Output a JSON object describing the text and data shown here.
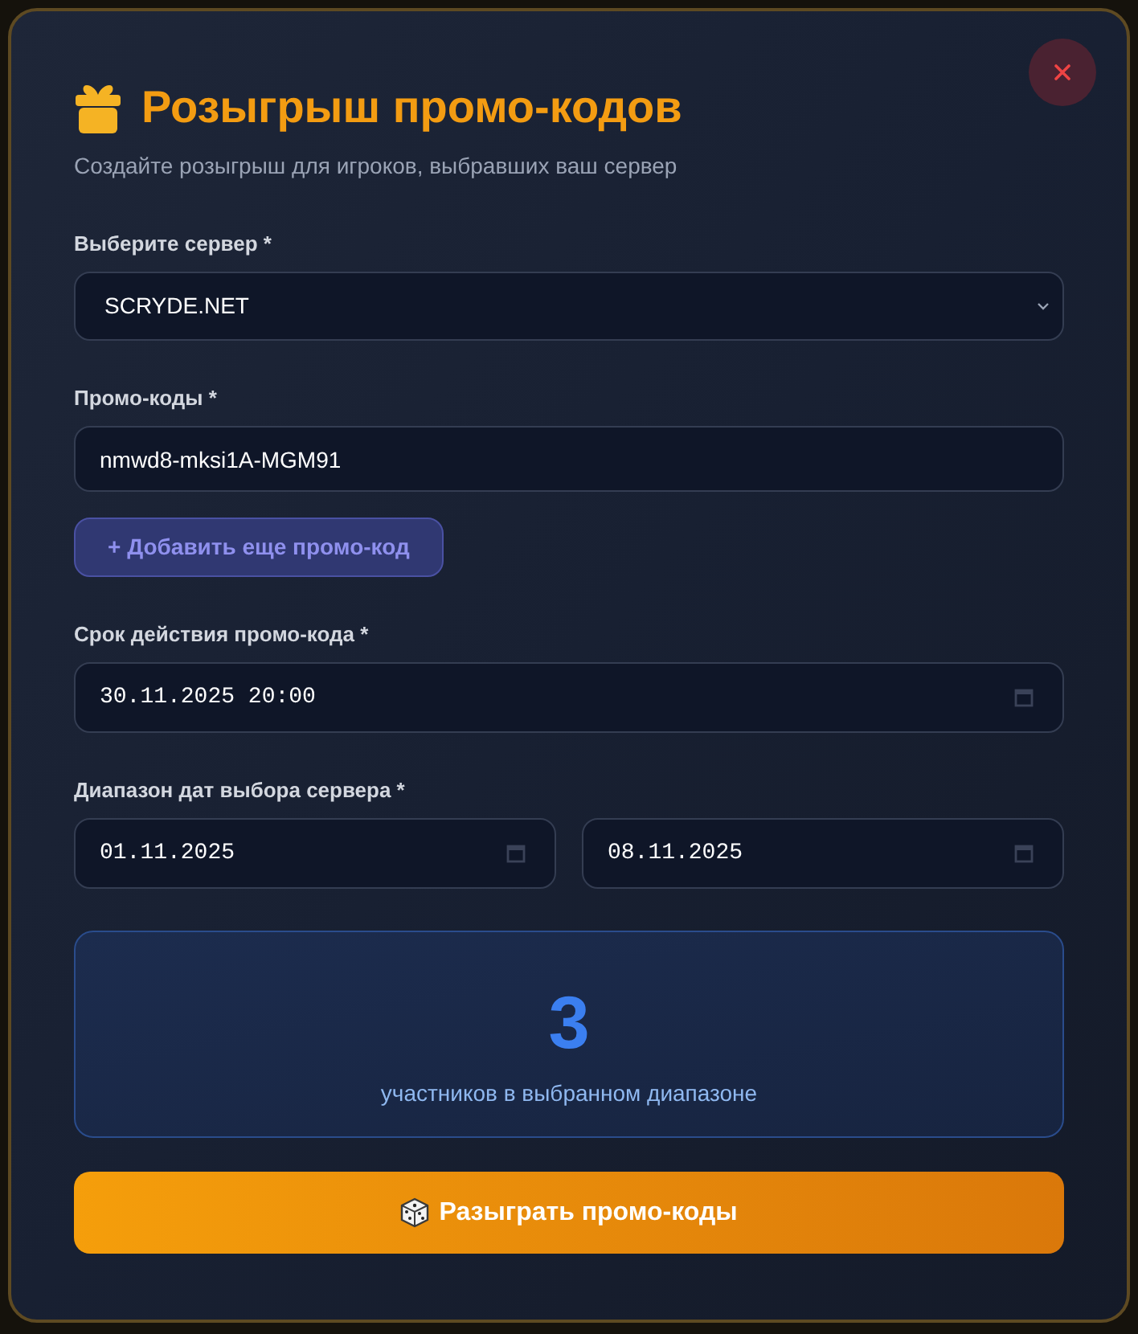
{
  "dialog": {
    "title": "Розыгрыш промо-кодов",
    "subtitle": "Создайте розыгрыш для игроков, выбравших ваш сервер"
  },
  "fields": [
    {
      "kind": "select",
      "label": "Выберите сервер *",
      "value": "SCRYDE.NET"
    },
    {
      "kind": "codes",
      "label": "Промо-коды *",
      "values": [
        "nmwd8-mksi1A-MGM91"
      ],
      "add_button": "+ Добавить еще промо-код"
    },
    {
      "kind": "datetime",
      "label": "Срок действия промо-кода *",
      "value": "30.11.2025 20:00"
    },
    {
      "kind": "date_range",
      "label": "Диапазон дат выбора сервера *",
      "values": [
        "01.11.2025",
        "08.11.2025"
      ]
    }
  ],
  "participants": {
    "count": "3",
    "caption": "участников в выбранном диапазоне"
  },
  "submit_button": {
    "label": "Разыграть промо-коды"
  }
}
